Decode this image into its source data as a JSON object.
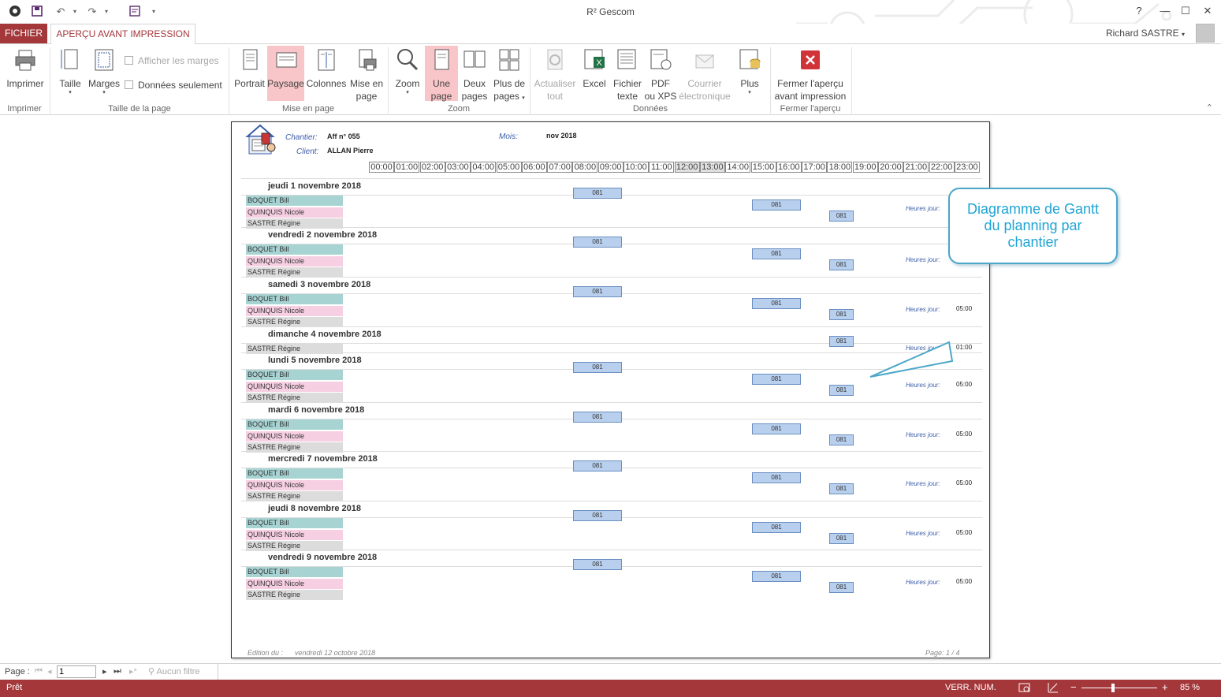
{
  "app": {
    "title": "R² Gescom"
  },
  "window": {
    "help": "?",
    "minimize": "—",
    "maximize": "☐",
    "close": "✕"
  },
  "tabs": {
    "file": "FICHIER",
    "active": "APERÇU AVANT IMPRESSION"
  },
  "user": {
    "name": "Richard SASTRE"
  },
  "ribbon": {
    "print": {
      "label": "Imprimer",
      "group": "Imprimer"
    },
    "page_size": {
      "group": "Taille de la page",
      "size": "Taille",
      "margins": "Marges",
      "show_margins": "Afficher les marges",
      "data_only": "Données seulement"
    },
    "layout": {
      "group": "Mise en page",
      "portrait": "Portrait",
      "landscape": "Paysage",
      "columns": "Colonnes",
      "page_setup_1": "Mise en",
      "page_setup_2": "page"
    },
    "zoom": {
      "group": "Zoom",
      "zoom": "Zoom",
      "one_page_1": "Une",
      "one_page_2": "page",
      "two_pages_1": "Deux",
      "two_pages_2": "pages",
      "more_pages_1": "Plus de",
      "more_pages_2": "pages"
    },
    "data": {
      "group": "Données",
      "refresh_1": "Actualiser",
      "refresh_2": "tout",
      "excel": "Excel",
      "text_1": "Fichier",
      "text_2": "texte",
      "pdf_1": "PDF",
      "pdf_2": "ou XPS",
      "email_1": "Courrier",
      "email_2": "électronique",
      "more": "Plus"
    },
    "close": {
      "group": "Fermer l'aperçu",
      "label_1": "Fermer l'aperçu",
      "label_2": "avant impression"
    }
  },
  "report": {
    "chantier_label": "Chantier:",
    "chantier_value": "Aff n° 055",
    "client_label": "Client:",
    "client_value": "ALLAN Pierre",
    "month_label": "Mois:",
    "month_value": "nov 2018",
    "hours": [
      "00:00",
      "01:00",
      "02:00",
      "03:00",
      "04:00",
      "05:00",
      "06:00",
      "07:00",
      "08:00",
      "09:00",
      "10:00",
      "11:00",
      "12:00",
      "13:00",
      "14:00",
      "15:00",
      "16:00",
      "17:00",
      "18:00",
      "19:00",
      "20:00",
      "21:00",
      "22:00",
      "23:00"
    ],
    "workers": {
      "b": "BOQUET Bill",
      "q": "QUINQUIS Nicole",
      "s": "SASTRE Régine"
    },
    "bar_label": "081",
    "hours_day_label": "Heures jour:",
    "days": [
      {
        "title": "jeudi 1 novembre 2018",
        "total": ""
      },
      {
        "title": "vendredi 2 novembre 2018",
        "total": ""
      },
      {
        "title": "samedi 3 novembre 2018",
        "total": "05:00"
      },
      {
        "title": "dimanche 4 novembre 2018",
        "total": "01:00"
      },
      {
        "title": "lundi 5 novembre 2018",
        "total": "05:00"
      },
      {
        "title": "mardi 6 novembre 2018",
        "total": "05:00"
      },
      {
        "title": "mercredi 7 novembre 2018",
        "total": "05:00"
      },
      {
        "title": "jeudi 8 novembre 2018",
        "total": "05:00"
      },
      {
        "title": "vendredi 9 novembre 2018",
        "total": "05:00"
      }
    ],
    "edition_label": "Edition du :",
    "edition_date": "vendredi 12 octobre 2018",
    "page_info": "Page: 1 / 4"
  },
  "callout": {
    "line1": "Diagramme de Gantt",
    "line2": "du planning par",
    "line3": "chantier"
  },
  "navigation": {
    "page_label": "Page :",
    "page_value": "1",
    "filter": "Aucun filtre"
  },
  "status": {
    "ready": "Prêt",
    "num_lock": "VERR. NUM.",
    "zoom": "85 %"
  },
  "colors": {
    "accent": "#a4373a",
    "callout": "#1fa4d4",
    "bar": "#b8d0ee"
  }
}
